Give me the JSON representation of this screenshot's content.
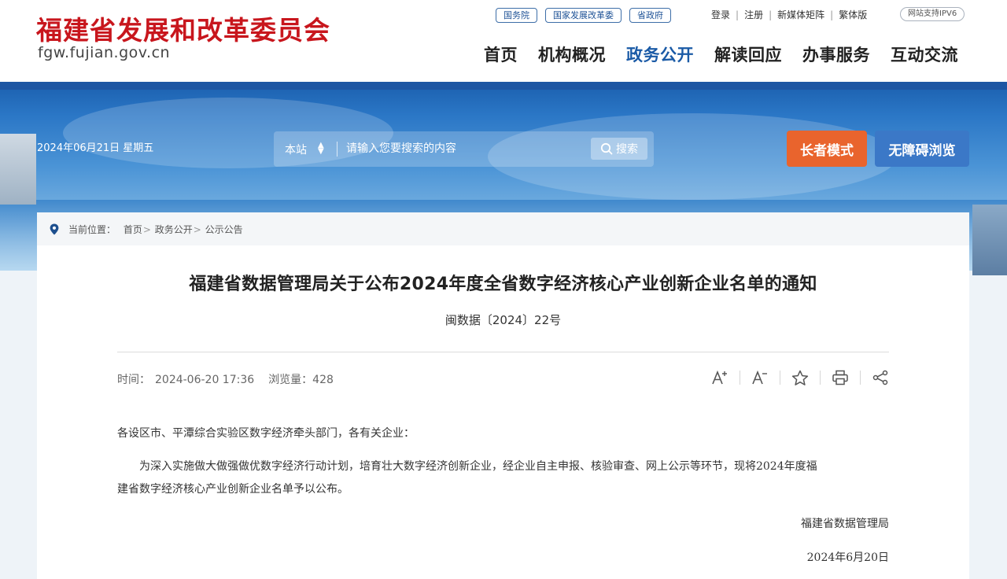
{
  "header": {
    "logo_cn": "福建省发展和改革委员会",
    "logo_en": "fgw.fujian.gov.cn",
    "tag_links": [
      "国务院",
      "国家发展改革委",
      "省政府"
    ],
    "util_links": [
      "登录",
      "注册",
      "新媒体矩阵",
      "繁体版"
    ],
    "ipv6": "网站支持IPV6",
    "nav": [
      "首页",
      "机构概况",
      "政务公开",
      "解读回应",
      "办事服务",
      "互动交流"
    ],
    "active_nav": "政务公开"
  },
  "banner": {
    "date": "2024年06月21日 星期五",
    "search": {
      "scope": "本站",
      "placeholder": "请输入您要搜索的内容",
      "button": "搜索"
    },
    "elder_mode": "长者模式",
    "accessible": "无障碍浏览"
  },
  "breadcrumb": {
    "label": "当前位置：",
    "items": [
      "首页",
      "政务公开",
      "公示公告"
    ]
  },
  "article": {
    "title": "福建省数据管理局关于公布2024年度全省数字经济核心产业创新企业名单的通知",
    "doc_no": "闽数据〔2024〕22号",
    "time_label": "时间：",
    "time": "2024-06-20 17:36",
    "views_label": "浏览量：",
    "views": "428",
    "para1": "各设区市、平潭综合实验区数字经济牵头部门，各有关企业：",
    "para2_line1": "为深入实施做大做强做优数字经济行动计划，培育壮大数字经济创新企业，经企业自主申报、核验审查、网上公示等环节，现将2024年度福",
    "para2_line2": "建省数字经济核心产业创新企业名单予以公布。",
    "signature": "福建省数据管理局",
    "sign_date": "2024年6月20日"
  },
  "colors": {
    "logo_red": "#c8161d",
    "nav_active": "#1a5aa6",
    "elder_button": "#e9642d",
    "access_button": "#3b78c7"
  },
  "icons": [
    "location-pin-icon",
    "search-icon",
    "font-increase-icon",
    "font-decrease-icon",
    "star-icon",
    "print-icon",
    "share-icon",
    "updown-arrow-icon"
  ]
}
